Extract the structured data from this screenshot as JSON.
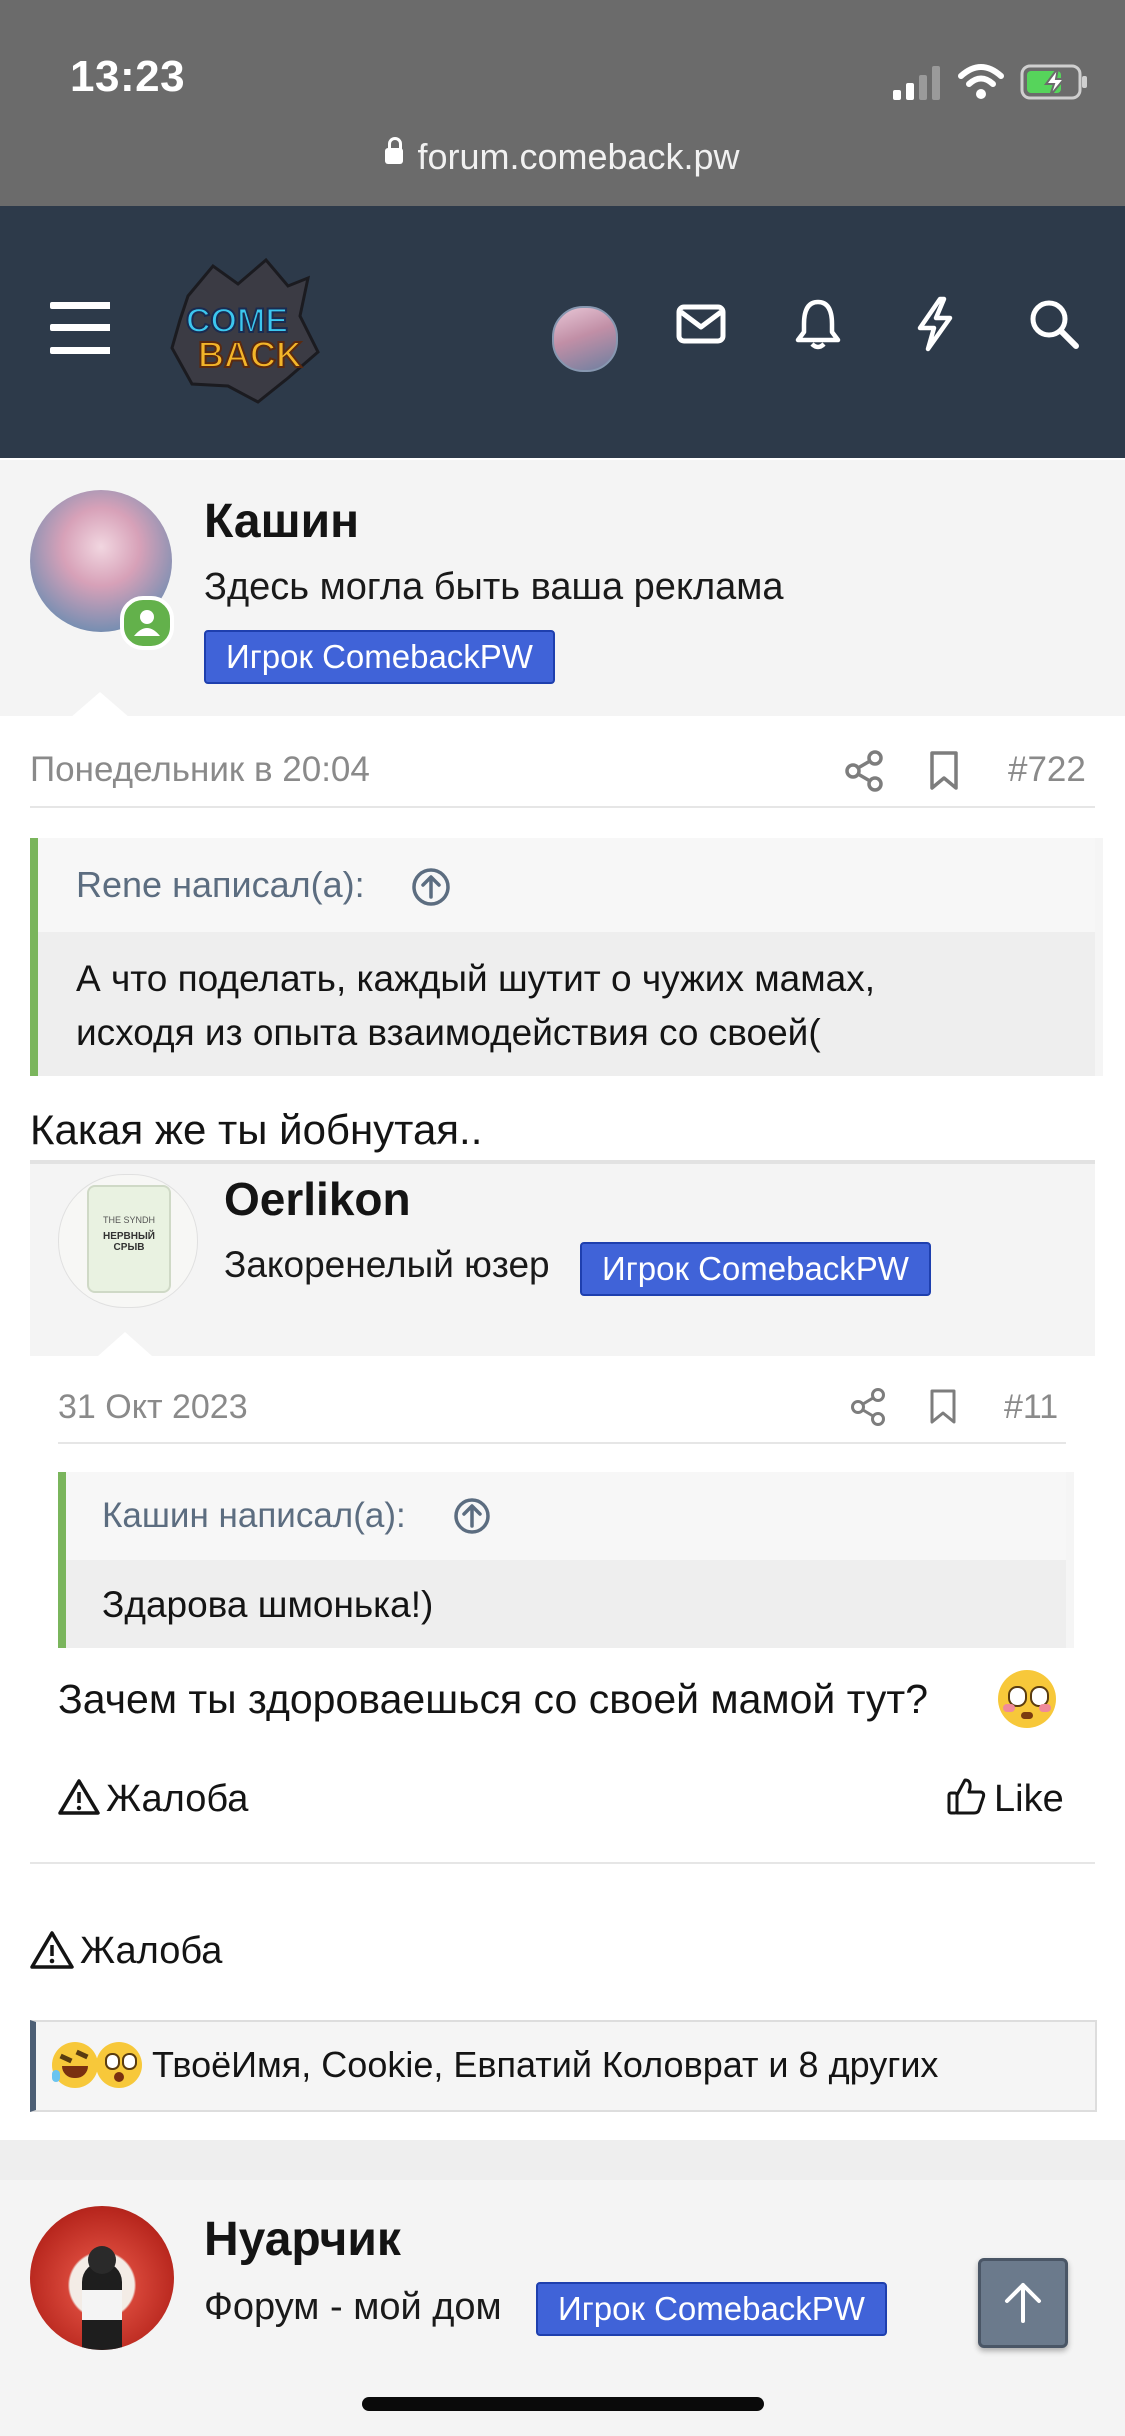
{
  "status": {
    "time": "13:23"
  },
  "browser": {
    "url": "forum.comeback.pw"
  },
  "header": {
    "logo_text_1": "COME",
    "logo_text_2": "BACK"
  },
  "post": {
    "author": "Кашин",
    "author_title": "Здесь могла быть ваша реклама",
    "badge": "Игрок ComebackPW",
    "date": "Понедельник в 20:04",
    "number": "#722",
    "quote": {
      "author": "Rene написал(а):",
      "text_line1": "А что поделать, каждый шутит о чужих мамах,",
      "text_line2": "исходя из опыта взаимодействия со своей("
    },
    "body": "Какая же ты йобнутая..",
    "report": "Жалоба",
    "reactions": "ТвоёИмя, Cookie, Евпатий Коловрат и 8 других"
  },
  "embedded": {
    "author": "Oerlikon",
    "author_title": "Закоренелый юзер",
    "badge": "Игрок ComebackPW",
    "avatar_text_1": "THE SYNDH",
    "avatar_text_2": "НЕРВНЫЙ СРЫВ",
    "date": "31 Окт 2023",
    "number": "#11",
    "quote": {
      "author": "Кашин написал(а):",
      "text": "Здарова шмонька!)"
    },
    "body": "Зачем ты здороваешься со своей мамой тут?",
    "report": "Жалоба",
    "like": "Like"
  },
  "next_post": {
    "author": "Нуарчик",
    "author_title": "Форум - мой дом",
    "badge": "Игрок ComebackPW"
  },
  "colors": {
    "nav_bg": "#2d3a4a",
    "badge": "#4063d8",
    "quote_bar": "#7ab55c",
    "online": "#63b14b"
  }
}
